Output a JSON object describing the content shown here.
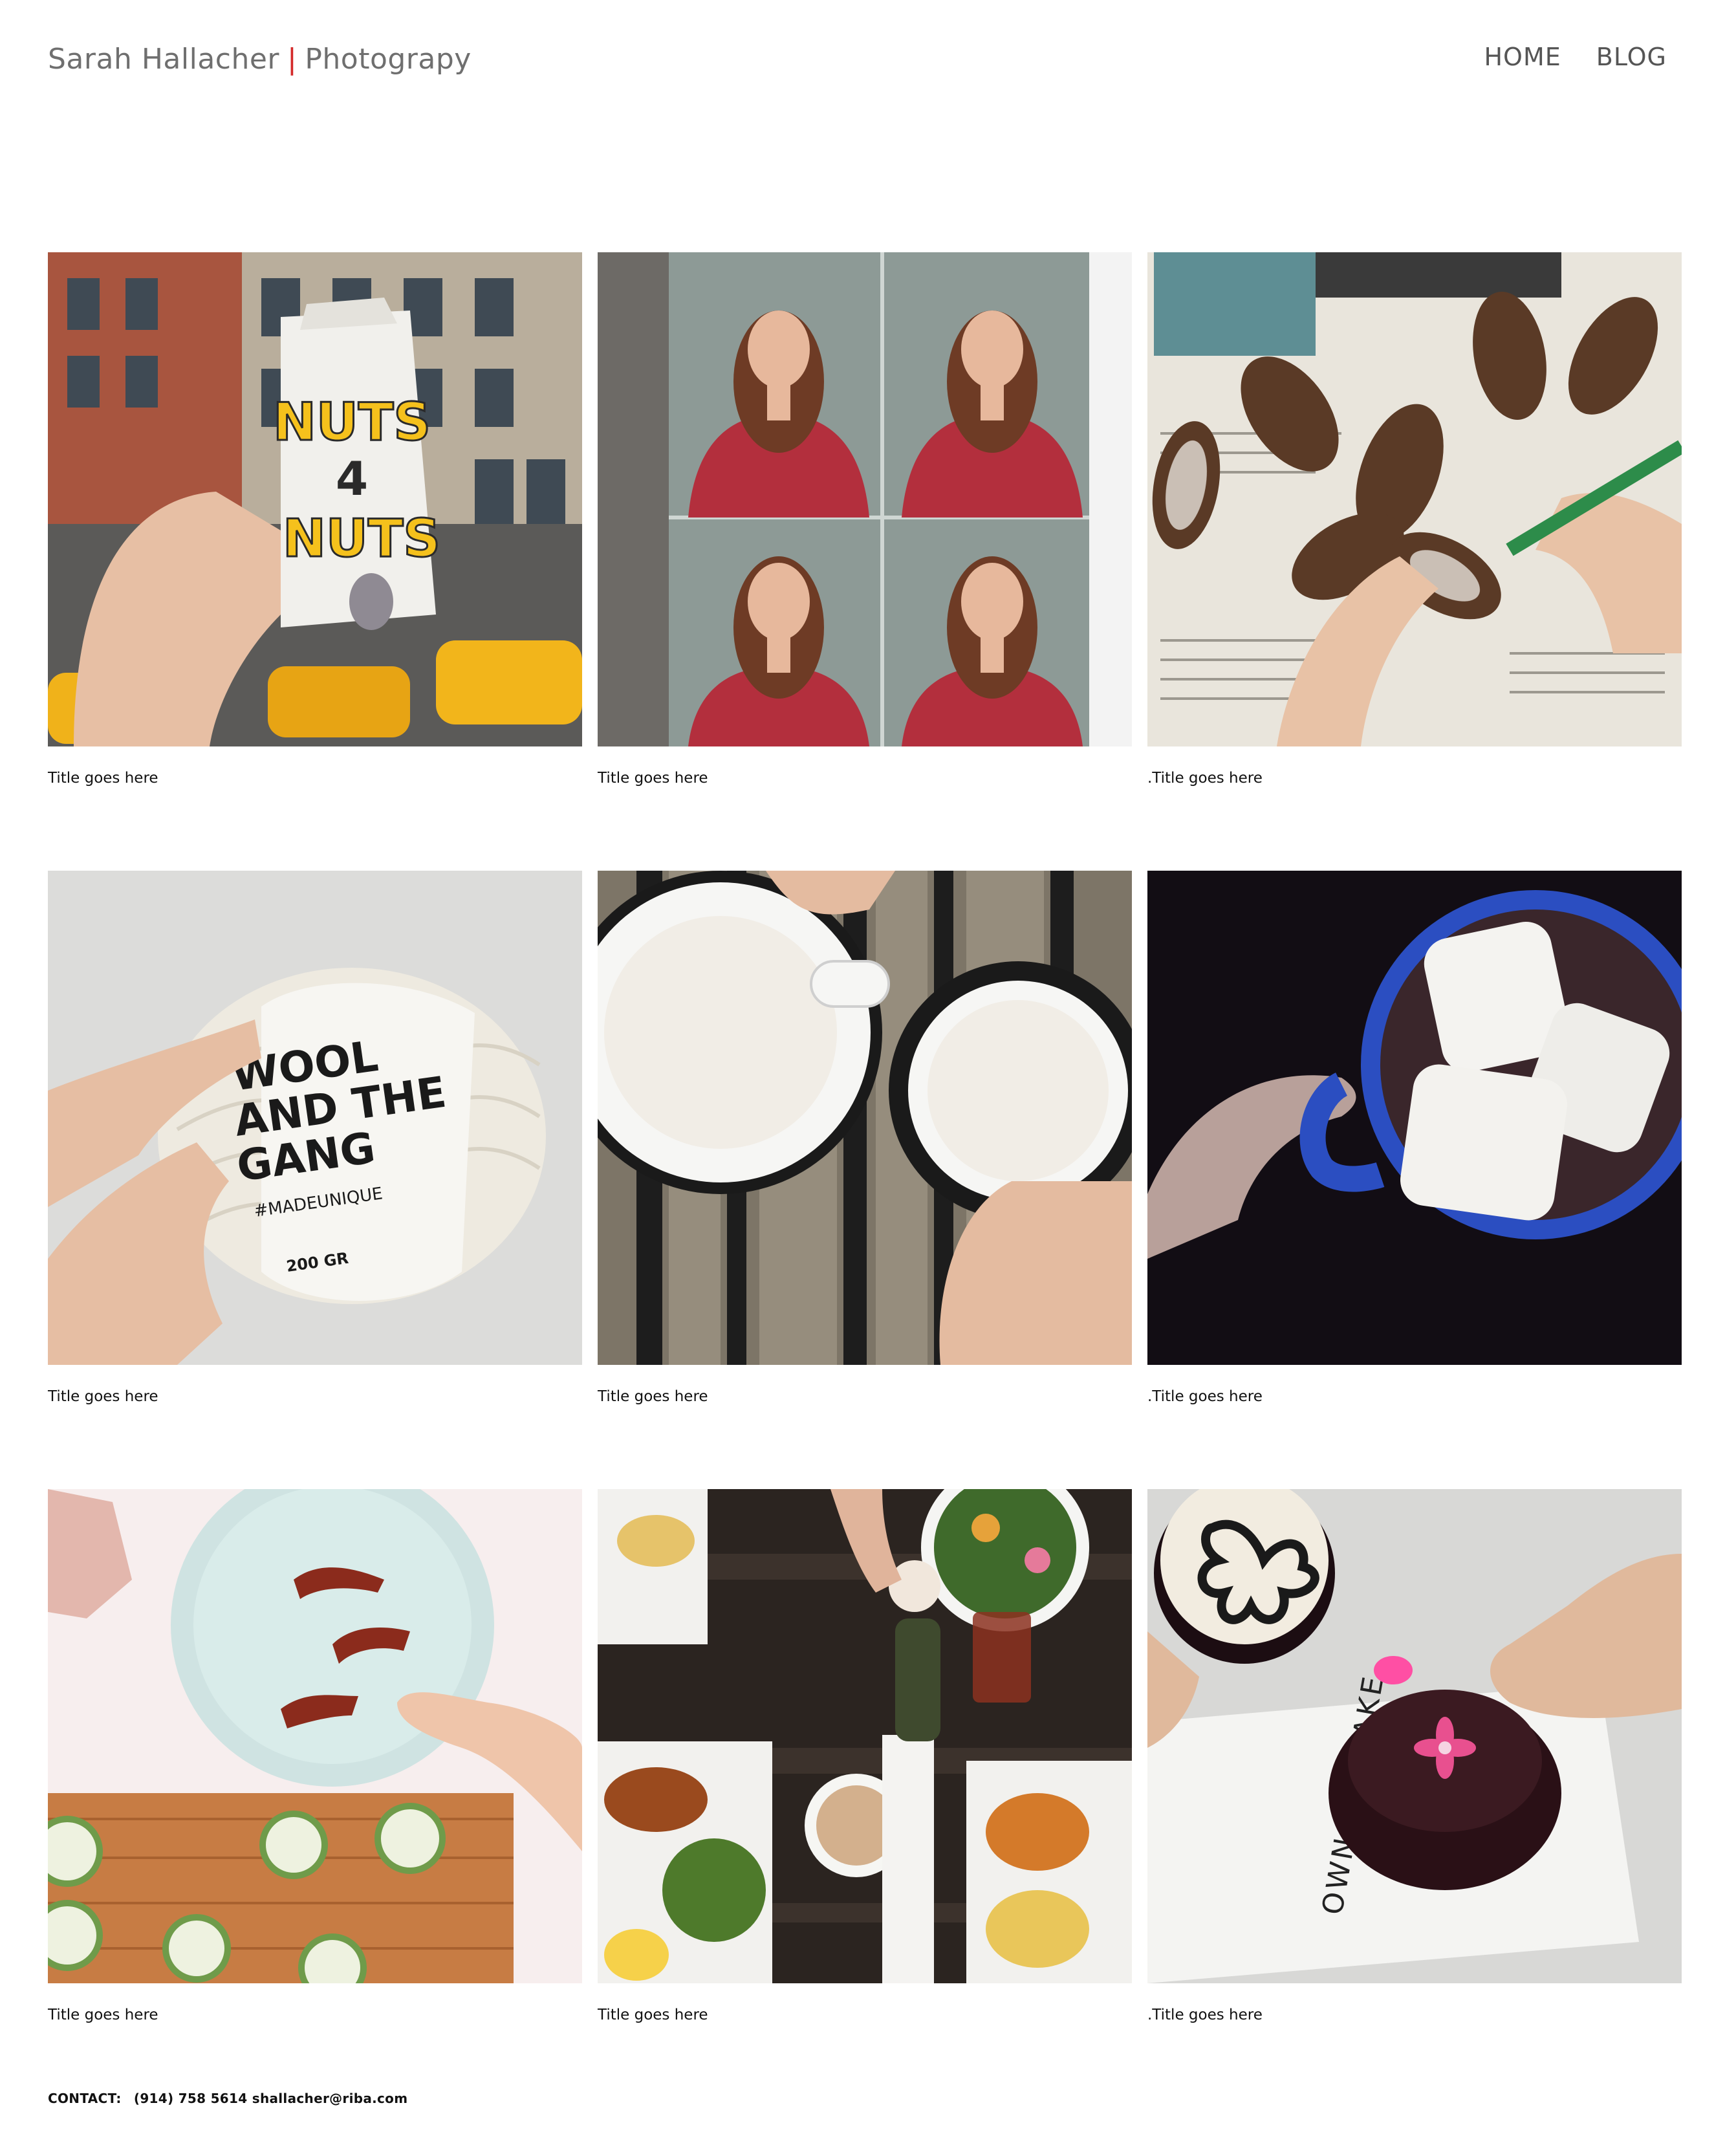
{
  "header": {
    "name": "Sarah Hallacher",
    "separator": "|",
    "tagline": "Photograpy",
    "nav": [
      {
        "label": "HOME"
      },
      {
        "label": "BLOG"
      }
    ]
  },
  "gallery": [
    {
      "caption": "Title goes here",
      "image": "nuts-4-nuts-bag-photo",
      "label_lines": [
        "NUTS",
        "4",
        "NUTS"
      ]
    },
    {
      "caption": "Title goes here",
      "image": "four-portraits-photo"
    },
    {
      "caption": ".Title goes here",
      "image": "pinecones-on-newspaper-photo"
    },
    {
      "caption": "Title goes here",
      "image": "wool-yarn-ball-photo",
      "label_lines": [
        "WOOL",
        "AND THE",
        "GANG"
      ],
      "label_sub": "#MADEUNIQUE",
      "label_weight": "200 GR"
    },
    {
      "caption": "Title goes here",
      "image": "two-coffee-cups-photo"
    },
    {
      "caption": ".Title goes here",
      "image": "hot-chocolate-marshmallows-photo"
    },
    {
      "caption": "Title goes here",
      "image": "bacon-and-zucchini-photo"
    },
    {
      "caption": "Title goes here",
      "image": "brunch-table-photo"
    },
    {
      "caption": ".Title goes here",
      "image": "cupcakes-photo",
      "label_lines": [
        "OWN CUPCAKE"
      ]
    }
  ],
  "footer": {
    "label": "CONTACT:",
    "phone": "(914) 758 5614",
    "email": "shallacher@riba.com"
  },
  "colors": {
    "brand_text": "#6f6f6f",
    "separator": "#d42a2a",
    "nav_text": "#555555"
  }
}
